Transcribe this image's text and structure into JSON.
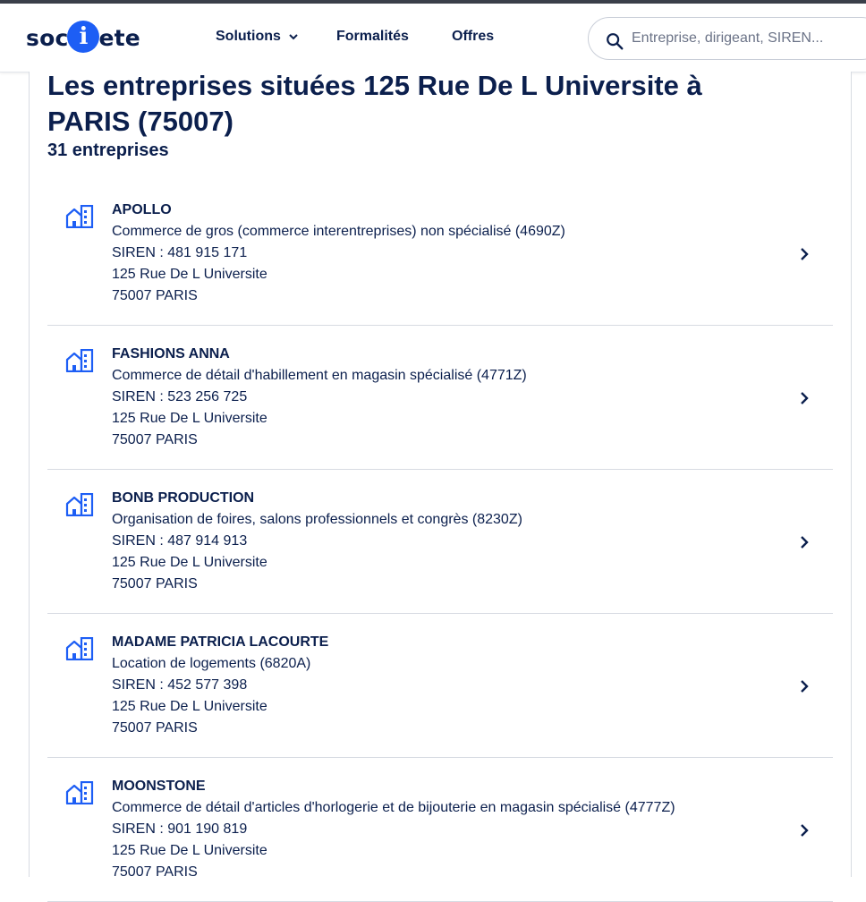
{
  "brand": {
    "logo_left": "soc",
    "logo_i": "i",
    "logo_right": "ete"
  },
  "nav": {
    "solutions": "Solutions",
    "formalites": "Formalités",
    "offres": "Offres"
  },
  "search": {
    "placeholder": "Entreprise, dirigeant, SIREN..."
  },
  "page": {
    "title": "Les entreprises situées 125 Rue De L Universite à PARIS (75007)",
    "count": "31 entreprises"
  },
  "companies": [
    {
      "name": "APOLLO",
      "activity": "Commerce de gros (commerce interentreprises) non spécialisé (4690Z)",
      "siren": "SIREN : 481 915 171",
      "street": "125 Rue De L Universite",
      "city": "75007 PARIS"
    },
    {
      "name": "FASHIONS ANNA",
      "activity": "Commerce de détail d'habillement en magasin spécialisé (4771Z)",
      "siren": "SIREN : 523 256 725",
      "street": "125 Rue De L Universite",
      "city": "75007 PARIS"
    },
    {
      "name": "BONB PRODUCTION",
      "activity": "Organisation de foires, salons professionnels et congrès (8230Z)",
      "siren": "SIREN : 487 914 913",
      "street": "125 Rue De L Universite",
      "city": "75007 PARIS"
    },
    {
      "name": "MADAME PATRICIA LACOURTE",
      "activity": "Location de logements (6820A)",
      "siren": "SIREN : 452 577 398",
      "street": "125 Rue De L Universite",
      "city": "75007 PARIS"
    },
    {
      "name": "MOONSTONE",
      "activity": "Commerce de détail d'articles d'horlogerie et de bijouterie en magasin spécialisé (4777Z)",
      "siren": "SIREN : 901 190 819",
      "street": "125 Rue De L Universite",
      "city": "75007 PARIS"
    }
  ],
  "icons": {
    "search": "search-icon",
    "company": "building-icon",
    "row_arrow": "chevron-right-icon",
    "menu_arrow": "chevron-down-icon"
  },
  "colors": {
    "brand_blue": "#1d5ef5",
    "text_navy": "#0b1f4d"
  }
}
